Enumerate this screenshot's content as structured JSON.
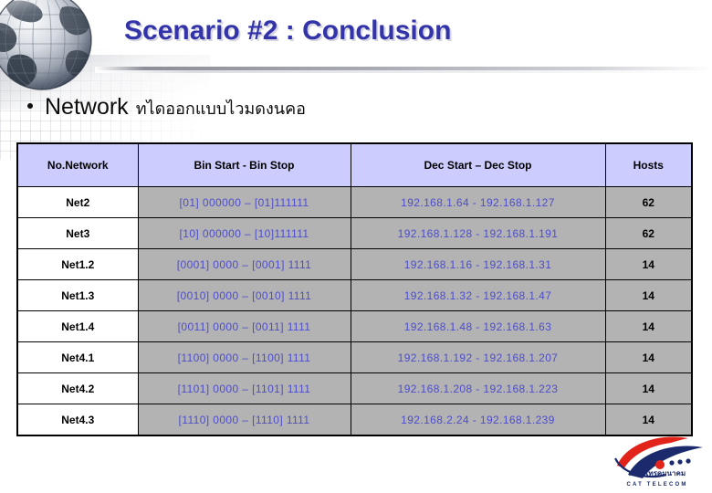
{
  "slide": {
    "title": "Scenario #2 : Conclusion",
    "title_color": "#3333AA",
    "bullet": {
      "marker": "bullet-dot",
      "main_text": "Network",
      "thai_text": "ทไดออกแบบไวมดงนคอ"
    }
  },
  "decor": {
    "globe_icon": "globe-icon",
    "divider": "title-divider"
  },
  "table": {
    "headers": [
      "No.Network",
      "Bin Start - Bin Stop",
      "Dec Start – Dec Stop",
      "Hosts"
    ],
    "header_bg": "#CCCCFF",
    "data_bg": "#B3B3B3",
    "data_text_color": "#4D4DCC",
    "rows": [
      {
        "network": "Net2",
        "bin": "[01] 000000 – [01]111111",
        "dec": "192.168.1.64 - 192.168.1.127",
        "hosts": "62"
      },
      {
        "network": "Net3",
        "bin": "[10] 000000 – [10]111111",
        "dec": "192.168.1.128 - 192.168.1.191",
        "hosts": "62"
      },
      {
        "network": "Net1.2",
        "bin": "[0001] 0000 – [0001] 1111",
        "dec": "192.168.1.16 - 192.168.1.31",
        "hosts": "14"
      },
      {
        "network": "Net1.3",
        "bin": "[0010] 0000 – [0010] 1111",
        "dec": "192.168.1.32 - 192.168.1.47",
        "hosts": "14"
      },
      {
        "network": "Net1.4",
        "bin": "[0011] 0000 – [0011] 1111",
        "dec": "192.168.1.48 - 192.168.1.63",
        "hosts": "14"
      },
      {
        "network": "Net4.1",
        "bin": "[1100] 0000 – [1100] 1111",
        "dec": "192.168.1.192 - 192.168.1.207",
        "hosts": "14"
      },
      {
        "network": "Net4.2",
        "bin": "[1101] 0000 – [1101] 1111",
        "dec": "192.168.1.208 - 192.168.1.223",
        "hosts": "14"
      },
      {
        "network": "Net4.3",
        "bin": "[1110] 0000 – [1110] 1111",
        "dec": "192.168.2.24 - 192.168.1.239",
        "hosts": "14"
      }
    ]
  },
  "logo": {
    "name": "cat-telecom-logo",
    "thai": "กสท โทรคมนาคม",
    "english": "CAT TELECOM",
    "colors": {
      "red": "#E2231A",
      "blue": "#1A2A6C"
    }
  }
}
